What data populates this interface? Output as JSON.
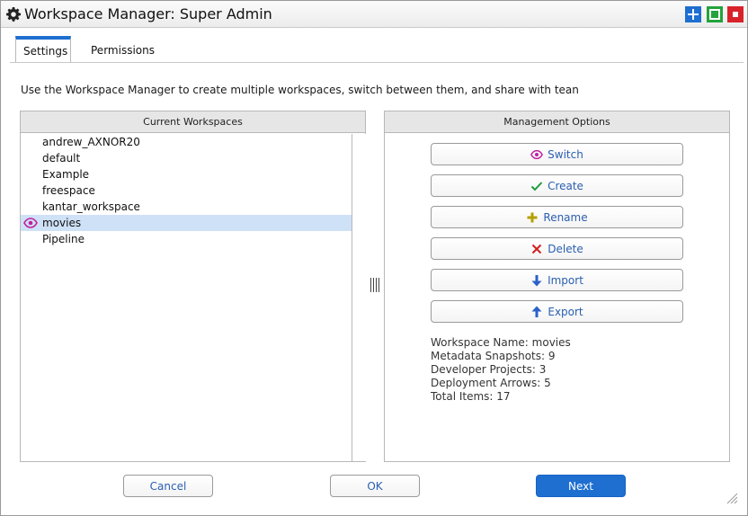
{
  "window": {
    "title": "Workspace Manager: Super Admin",
    "accent": "#1e6fd0"
  },
  "titlebar_icons": [
    "gear-icon",
    "plus-icon",
    "maximize-icon",
    "close-icon"
  ],
  "tabs": [
    {
      "label": "Settings",
      "active": true
    },
    {
      "label": "Permissions",
      "active": false
    }
  ],
  "description": "Use the Workspace Manager to create multiple workspaces, switch between them, and share with tean",
  "workspaces": {
    "header": "Current Workspaces",
    "items": [
      {
        "label": "andrew_AXNOR20",
        "selected": false
      },
      {
        "label": "default",
        "selected": false
      },
      {
        "label": "Example",
        "selected": false
      },
      {
        "label": "freespace",
        "selected": false
      },
      {
        "label": "kantar_workspace",
        "selected": false
      },
      {
        "label": "movies",
        "selected": true
      },
      {
        "label": "Pipeline",
        "selected": false
      }
    ]
  },
  "management": {
    "header": "Management Options",
    "buttons": [
      {
        "label": "Switch",
        "icon": "eye-icon",
        "color": "#c020a0"
      },
      {
        "label": "Create",
        "icon": "check-icon",
        "color": "#1f9a3a"
      },
      {
        "label": "Rename",
        "icon": "plus-icon",
        "color": "#b5a000"
      },
      {
        "label": "Delete",
        "icon": "x-icon",
        "color": "#d02020"
      },
      {
        "label": "Import",
        "icon": "arrow-down-icon",
        "color": "#2a62c9"
      },
      {
        "label": "Export",
        "icon": "arrow-up-icon",
        "color": "#2a62c9"
      }
    ],
    "info": [
      "Workspace Name: movies",
      "Metadata Snapshots: 9",
      "Developer Projects: 3",
      "Deployment Arrows: 5",
      "Total Items: 17"
    ]
  },
  "footer": {
    "cancel": "Cancel",
    "ok": "OK",
    "next": "Next"
  }
}
